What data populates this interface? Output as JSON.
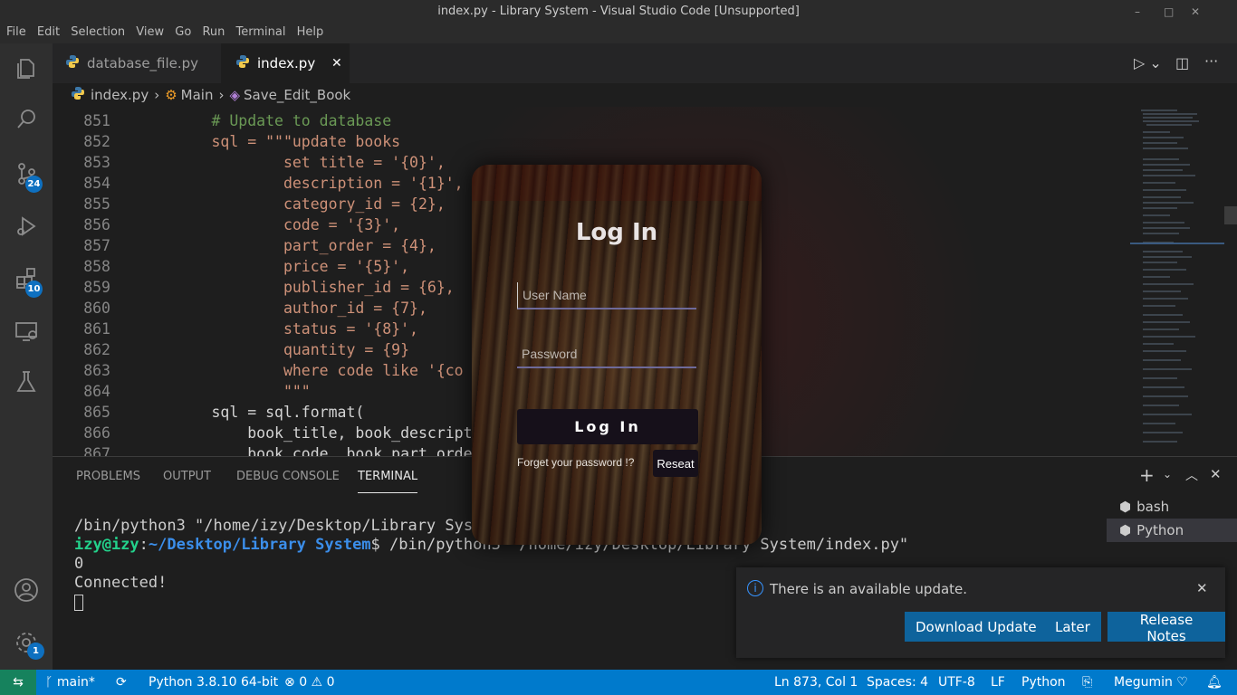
{
  "window": {
    "title": "index.py - Library System - Visual Studio Code [Unsupported]"
  },
  "menu": [
    "File",
    "Edit",
    "Selection",
    "View",
    "Go",
    "Run",
    "Terminal",
    "Help"
  ],
  "activity_badges": {
    "source_control": "24",
    "extensions": "10",
    "settings": "1"
  },
  "tabs": [
    {
      "label": "database_file.py",
      "active": false
    },
    {
      "label": "index.py",
      "active": true
    }
  ],
  "breadcrumb": {
    "file": "index.py",
    "class": "Main",
    "method": "Save_Edit_Book"
  },
  "editor": {
    "lines": [
      {
        "num": "851",
        "text": "        # Update to database",
        "kind": "comment"
      },
      {
        "num": "852",
        "text": "        sql = \"\"\"update books",
        "kind": "str"
      },
      {
        "num": "853",
        "text": "                set title = '{0}',",
        "kind": "str"
      },
      {
        "num": "854",
        "text": "                description = '{1}',",
        "kind": "str"
      },
      {
        "num": "855",
        "text": "                category_id = {2},",
        "kind": "str"
      },
      {
        "num": "856",
        "text": "                code = '{3}',",
        "kind": "str"
      },
      {
        "num": "857",
        "text": "                part_order = {4},",
        "kind": "str"
      },
      {
        "num": "858",
        "text": "                price = '{5}',",
        "kind": "str"
      },
      {
        "num": "859",
        "text": "                publisher_id = {6},",
        "kind": "str"
      },
      {
        "num": "860",
        "text": "                author_id = {7},",
        "kind": "str"
      },
      {
        "num": "861",
        "text": "                status = '{8}',",
        "kind": "str"
      },
      {
        "num": "862",
        "text": "                quantity = {9}",
        "kind": "str"
      },
      {
        "num": "863",
        "text": "                where code like '{co",
        "kind": "str"
      },
      {
        "num": "864",
        "text": "                \"\"\"",
        "kind": "str"
      },
      {
        "num": "865",
        "text": "        sql = sql.format(",
        "kind": "plain"
      },
      {
        "num": "866",
        "text": "            book_title, book_descript",
        "kind": "plain"
      },
      {
        "num": "867",
        "text": "            book_code, book_part_orde",
        "kind": "plain"
      }
    ]
  },
  "panel": {
    "tabs": [
      "PROBLEMS",
      "OUTPUT",
      "DEBUG CONSOLE",
      "TERMINAL"
    ],
    "active_tab": "TERMINAL",
    "terminal": {
      "line1": "/bin/python3 \"/home/izy/Desktop/Library Syst",
      "prompt_user": "izy@izy",
      "prompt_sep": ":",
      "prompt_path": "~/Desktop/Library System",
      "prompt_cmd": "$ /bin/python3 \"/home/izy/Desktop/Library System/index.py\"",
      "line3": "0",
      "line4": "Connected!"
    },
    "terminals": [
      "bash",
      "Python"
    ]
  },
  "login": {
    "title": "Log In",
    "username_placeholder": "User Name",
    "password_placeholder": "Password",
    "button": "Log In",
    "forget": "Forget your password !?",
    "reset": "Reseat"
  },
  "notification": {
    "message": "There is an available update.",
    "buttons": [
      "Download Update",
      "Later",
      "Release Notes"
    ]
  },
  "statusbar": {
    "branch": "main*",
    "python": "Python 3.8.10 64-bit",
    "errors": "0",
    "warnings": "0",
    "position": "Ln 873, Col 1",
    "spaces": "Spaces: 4",
    "encoding": "UTF-8",
    "eol": "LF",
    "language": "Python",
    "account": "Megumin"
  }
}
